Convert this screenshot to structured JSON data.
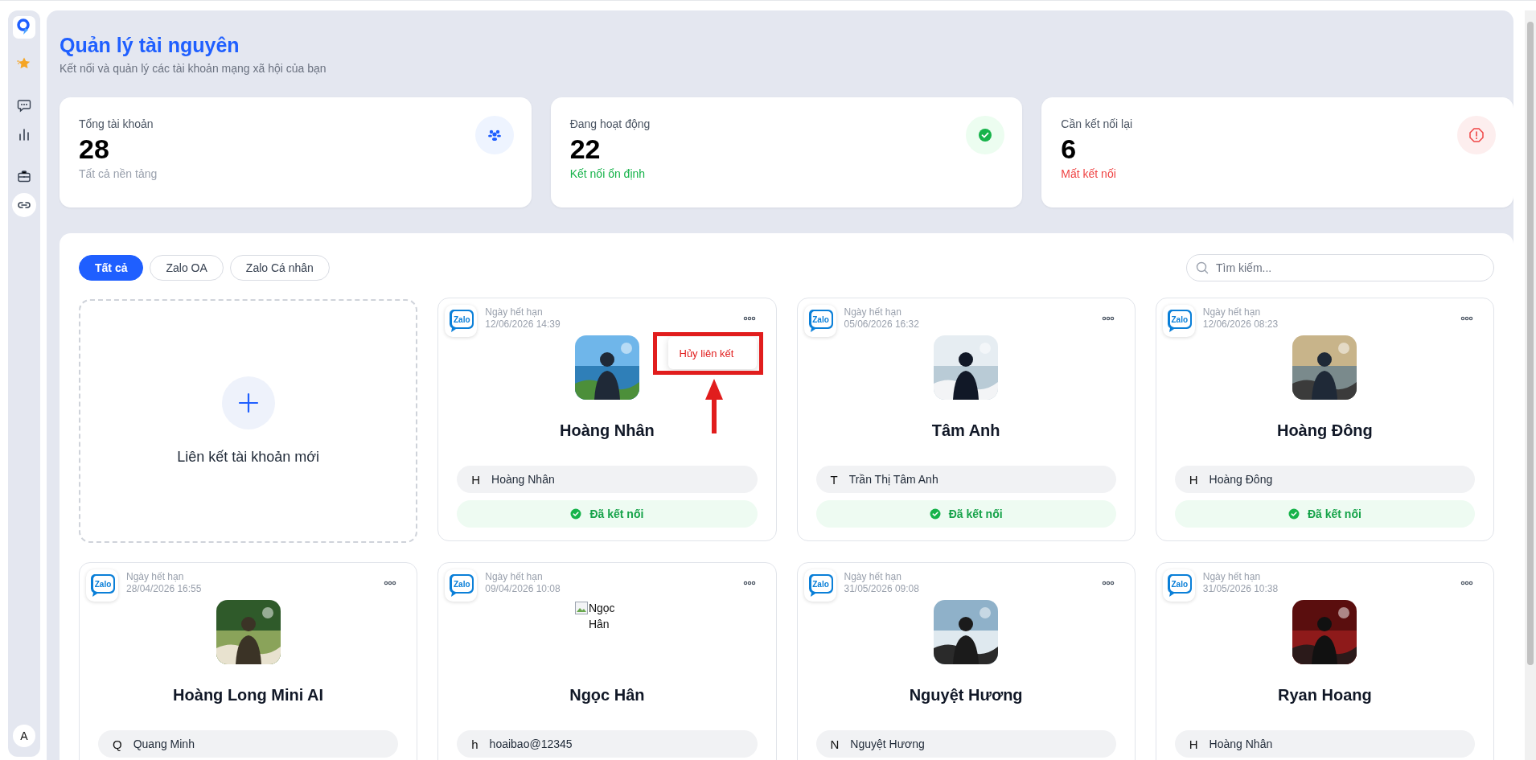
{
  "sidebar": {
    "items": [
      {
        "kind": "star",
        "selected": false
      },
      {
        "kind": "chat",
        "selected": false
      },
      {
        "kind": "chart",
        "selected": false
      },
      {
        "kind": "briefcase",
        "selected": false
      },
      {
        "kind": "link",
        "selected": true
      }
    ],
    "user_initial": "A"
  },
  "header": {
    "title": "Quản lý tài nguyên",
    "subtitle": "Kết nối và quản lý các tài khoản mạng xã hội của bạn"
  },
  "stats": [
    {
      "kind": "total",
      "label": "Tổng tài khoản",
      "value": "28",
      "note": "Tất cả nền tảng"
    },
    {
      "kind": "active",
      "label": "Đang hoạt động",
      "value": "22",
      "note": "Kết nối ổn định"
    },
    {
      "kind": "warning",
      "label": "Cần kết nối lại",
      "value": "6",
      "note": "Mất kết nối"
    }
  ],
  "tabs": [
    {
      "label": "Tất cả",
      "selected": true
    },
    {
      "label": "Zalo OA",
      "selected": false
    },
    {
      "label": "Zalo Cá nhân",
      "selected": false
    }
  ],
  "search": {
    "placeholder": "Tìm kiếm..."
  },
  "add_card": {
    "label": "Liên kết tài khoản mới"
  },
  "cards": [
    {
      "platform": "Zalo",
      "expiry_label": "Ngày hết hạn",
      "expiry": "12/06/2026 14:39",
      "name": "Hoàng Nhân",
      "account_initial": "H",
      "account": "Hoàng Nhân",
      "status": "Đã kết nối",
      "menu": {
        "items": [
          "Hủy liên kết"
        ],
        "highlighted": true
      }
    },
    {
      "platform": "Zalo",
      "expiry_label": "Ngày hết hạn",
      "expiry": "05/06/2026 16:32",
      "name": "Tâm Anh",
      "account_initial": "T",
      "account": "Trần Thị Tâm Anh",
      "status": "Đã kết nối"
    },
    {
      "platform": "Zalo",
      "expiry_label": "Ngày hết hạn",
      "expiry": "12/06/2026 08:23",
      "name": "Hoàng Đông",
      "account_initial": "H",
      "account": "Hoàng Đông",
      "status": "Đã kết nối"
    },
    {
      "platform": "Zalo",
      "expiry_label": "Ngày hết hạn",
      "expiry": "28/04/2026 16:55",
      "name": "Hoàng Long Mini AI",
      "account_initial": "Q",
      "account": "Quang Minh"
    },
    {
      "platform": "Zalo",
      "expiry_label": "Ngày hết hạn",
      "expiry": "09/04/2026 10:08",
      "avatar": {
        "kind": "broken",
        "alt": "Ngọc Hân"
      },
      "name": "Ngọc Hân",
      "account_initial": "h",
      "account": "hoaibao@12345"
    },
    {
      "platform": "Zalo",
      "expiry_label": "Ngày hết hạn",
      "expiry": "31/05/2026 09:08",
      "name": "Nguyệt Hương",
      "account_initial": "N",
      "account": "Nguyệt Hương"
    },
    {
      "platform": "Zalo",
      "expiry_label": "Ngày hết hạn",
      "expiry": "31/05/2026 10:38",
      "name": "Ryan Hoang",
      "account_initial": "H",
      "account": "Hoàng Nhân"
    }
  ]
}
